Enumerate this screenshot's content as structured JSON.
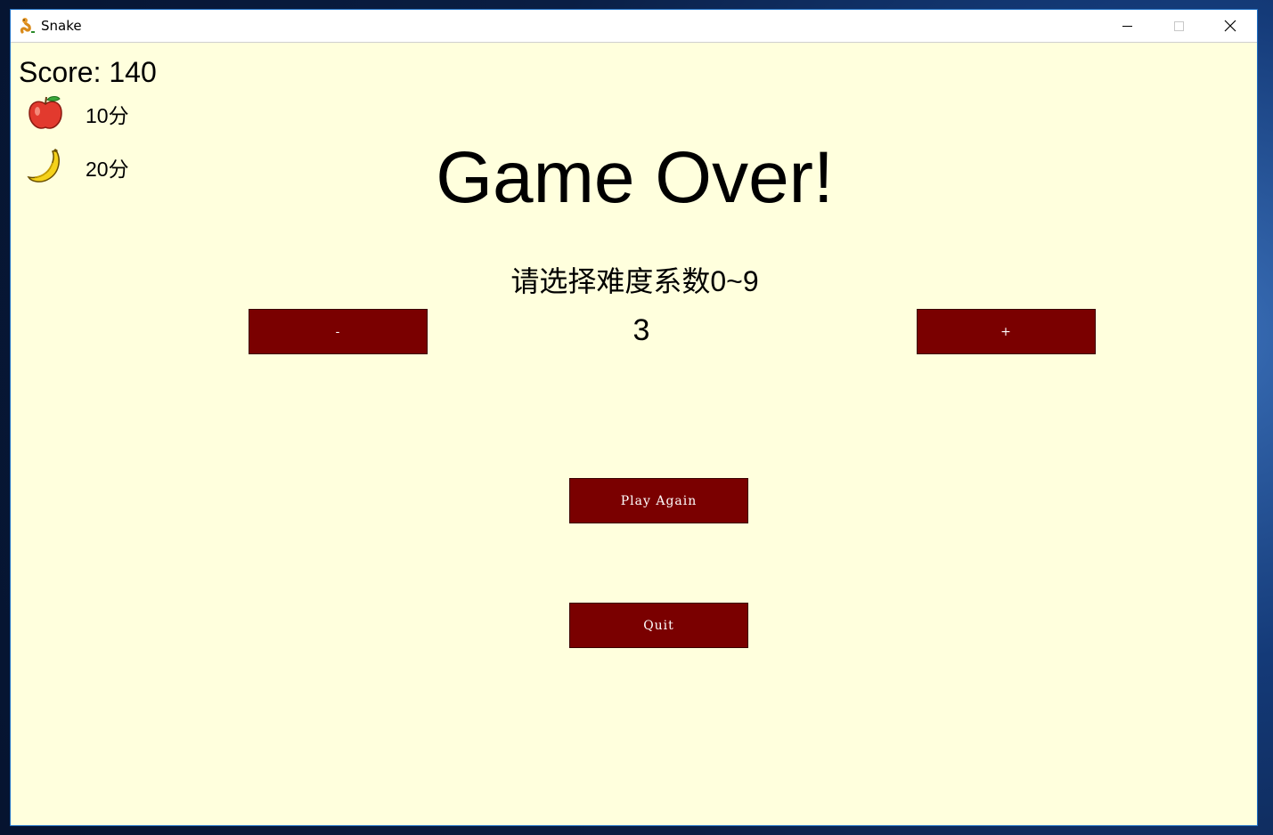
{
  "window": {
    "title": "Snake",
    "icon": "snake-icon",
    "controls": [
      "minimize-icon",
      "maximize-icon",
      "close-icon"
    ]
  },
  "hud": {
    "score_label": "Score: 140",
    "fruits": [
      {
        "icon": "apple-icon",
        "points": "10分"
      },
      {
        "icon": "banana-icon",
        "points": "20分"
      }
    ]
  },
  "main": {
    "headline": "Game Over!",
    "difficulty_prompt": "请选择难度系数0~9",
    "difficulty_value": "3",
    "decrease_label": "-",
    "increase_label": "+",
    "play_again_label": "Play Again",
    "quit_label": "Quit"
  },
  "colors": {
    "background": "#ffffdd",
    "button": "#7a0000",
    "button_text": "#ffffff"
  }
}
